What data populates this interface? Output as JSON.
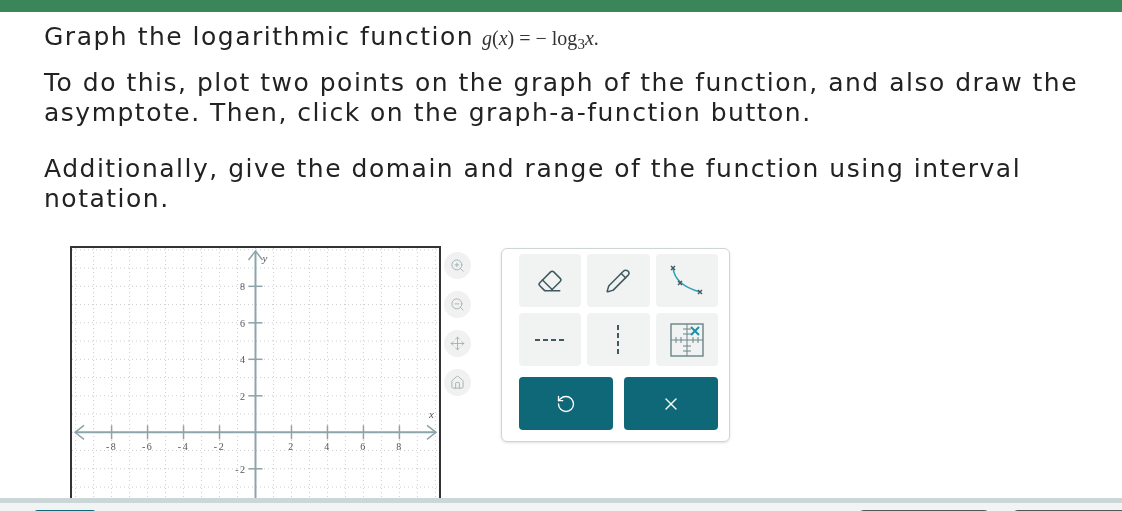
{
  "question": {
    "prompt": "Graph the logarithmic function",
    "formula": "*g*(*x*) = − log$_{3}$*x*.",
    "paragraphs": [
      "To do this, plot two points on the graph of the function, and also draw the asymptote. Then, click on the graph-a-function button.",
      "Additionally, give the domain and range of the function using interval notation."
    ]
  },
  "graph": {
    "chart_data": {
      "type": "line",
      "grid": true,
      "xlabel": "x",
      "ylabel": "y",
      "xlim": [
        -10.2,
        10.2
      ],
      "ylim": [
        -3.6,
        10.1
      ],
      "xticks": [
        -8,
        -6,
        -4,
        -2,
        2,
        4,
        6,
        8
      ],
      "yticks": [
        -2,
        2,
        4,
        6,
        8
      ]
    }
  },
  "zoom_tools": [
    {
      "kind": "zoom-in"
    },
    {
      "kind": "zoom-out"
    },
    {
      "kind": "pan"
    },
    {
      "kind": "home"
    }
  ],
  "tools": [
    {
      "kind": "eraser"
    },
    {
      "kind": "pencil"
    },
    {
      "kind": "curve"
    },
    {
      "kind": "horizontal"
    },
    {
      "kind": "vertical"
    },
    {
      "kind": "point"
    }
  ],
  "actions": [
    {
      "kind": "undo"
    },
    {
      "kind": "clear"
    }
  ]
}
